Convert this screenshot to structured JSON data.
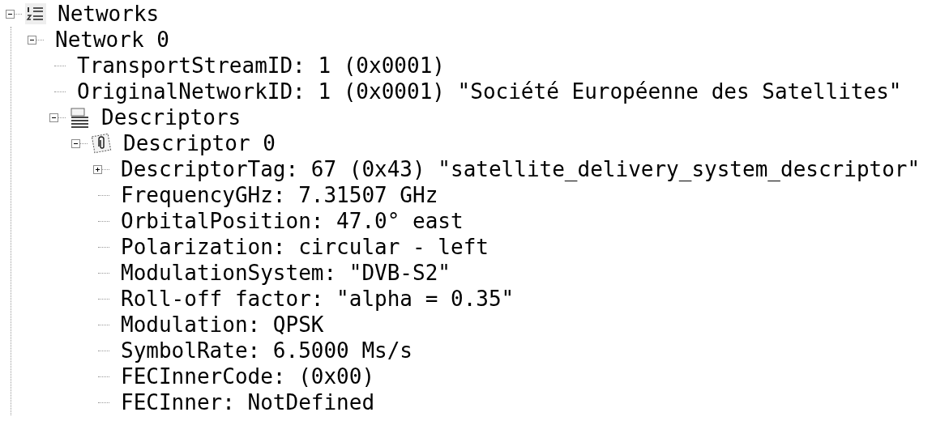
{
  "tree": [
    {
      "label": "Networks",
      "kind": "list",
      "expanded": true,
      "children": [
        {
          "label": "Network 0",
          "expanded": true,
          "children": [
            {
              "label": "TransportStreamID: 1 (0x0001)"
            },
            {
              "label": "OriginalNetworkID: 1 (0x0001) \"Société Européenne des Satellites\""
            },
            {
              "label": "Descriptors",
              "kind": "stack",
              "expanded": true,
              "children": [
                {
                  "label": "Descriptor 0",
                  "kind": "stamp",
                  "expanded": true,
                  "children": [
                    {
                      "label": "DescriptorTag: 67 (0x43) \"satellite_delivery_system_descriptor\"",
                      "expanded": false
                    },
                    {
                      "label": "FrequencyGHz: 7.31507 GHz"
                    },
                    {
                      "label": "OrbitalPosition: 47.0° east"
                    },
                    {
                      "label": "Polarization: circular - left"
                    },
                    {
                      "label": "ModulationSystem: \"DVB-S2\""
                    },
                    {
                      "label": "Roll-off factor: \"alpha = 0.35\""
                    },
                    {
                      "label": "Modulation: QPSK"
                    },
                    {
                      "label": "SymbolRate: 6.5000 Ms/s"
                    },
                    {
                      "label": "FECInnerCode: (0x00)"
                    },
                    {
                      "label": "FECInner: NotDefined"
                    }
                  ]
                }
              ]
            }
          ]
        }
      ]
    }
  ]
}
